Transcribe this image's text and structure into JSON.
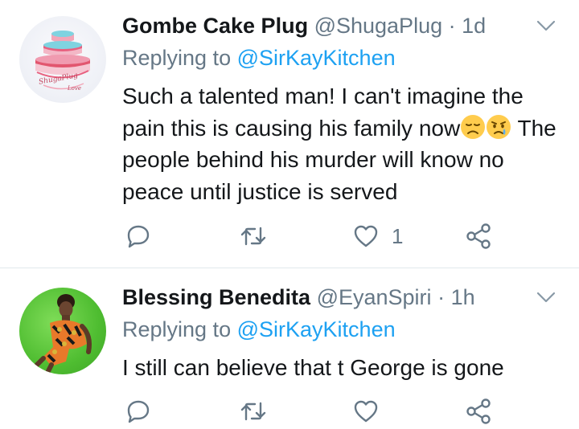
{
  "tweets": [
    {
      "author_name": "Gombe Cake Plug",
      "handle": "@ShugaPlug",
      "separator": "·",
      "time": "1d",
      "replying_prefix": "Replying to",
      "replying_to": "@SirKayKitchen",
      "text": "Such a talented man! I can't imagine the pain this is causing his family now",
      "text_after": "The people behind his murder will know no peace until justice is served",
      "emojis": [
        "disappointed-face",
        "crying-face"
      ],
      "avatar_logo_text": "ShugaPlug Love",
      "likes": "1"
    },
    {
      "author_name": "Blessing Benedita",
      "handle": "@EyanSpiri",
      "separator": "·",
      "time": "1h",
      "replying_prefix": "Replying to",
      "replying_to": "@SirKayKitchen",
      "text": "I still can believe that t George is gone",
      "likes": ""
    }
  ],
  "colors": {
    "name": "#14171a",
    "secondary": "#657786",
    "mention": "#1da1f2",
    "divider": "#e1e8ed"
  }
}
